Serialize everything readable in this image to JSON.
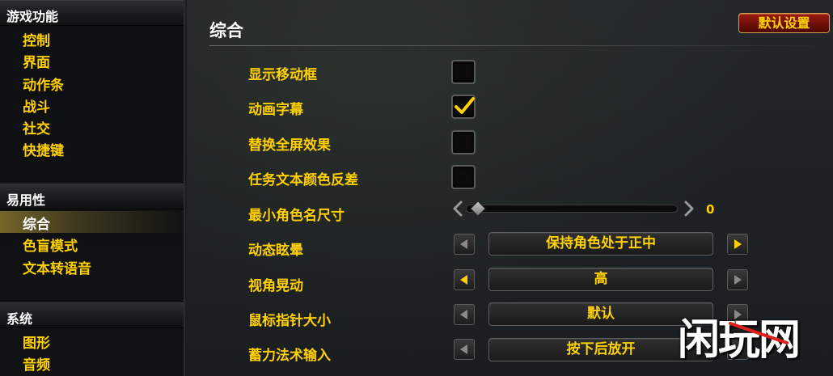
{
  "sidebar": {
    "sections": [
      {
        "header": "游戏功能",
        "items": [
          "控制",
          "界面",
          "动作条",
          "战斗",
          "社交",
          "快捷键"
        ]
      },
      {
        "header": "易用性",
        "items": [
          "综合",
          "色盲模式",
          "文本转语音"
        ]
      },
      {
        "header": "系统",
        "items": [
          "图形",
          "音频"
        ]
      }
    ],
    "selected": "综合"
  },
  "main": {
    "title": "综合",
    "default_button": "默认设置",
    "options": [
      {
        "label": "显示移动框",
        "type": "checkbox",
        "checked": false
      },
      {
        "label": "动画字幕",
        "type": "checkbox",
        "checked": true
      },
      {
        "label": "替换全屏效果",
        "type": "checkbox",
        "checked": false
      },
      {
        "label": "任务文本颜色反差",
        "type": "checkbox",
        "checked": false
      },
      {
        "label": "最小角色名尺寸",
        "type": "slider",
        "value": "0"
      },
      {
        "label": "动态眩晕",
        "type": "dropdown",
        "value": "保持角色处于正中"
      },
      {
        "label": "视角晃动",
        "type": "dropdown",
        "value": "高"
      },
      {
        "label": "鼠标指针大小",
        "type": "dropdown",
        "value": "默认"
      },
      {
        "label": "蓄力法术输入",
        "type": "dropdown",
        "value": "按下后放开"
      }
    ]
  },
  "watermark": {
    "text": "闲玩网"
  },
  "colors": {
    "accent": "#ffd100",
    "button_red": "#8a1409",
    "selected_bg": "#b89a3a"
  }
}
